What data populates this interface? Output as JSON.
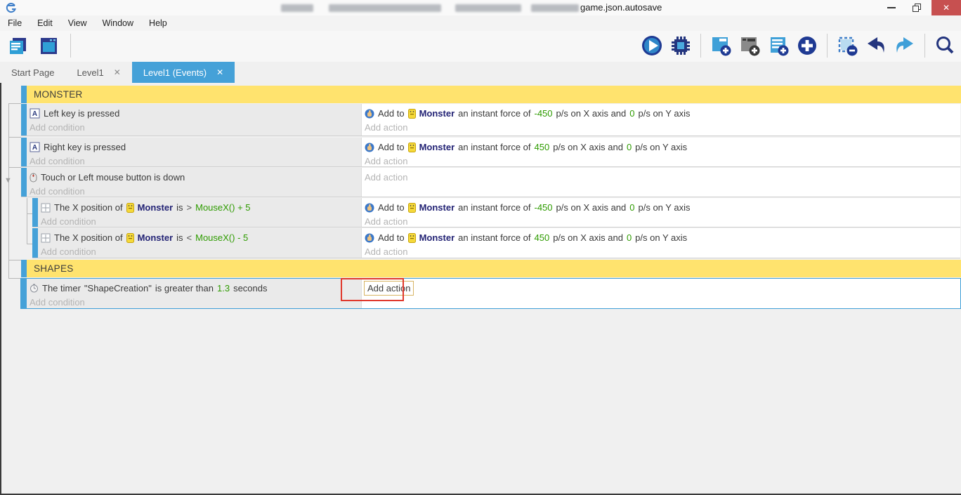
{
  "window": {
    "title_suffix": "game.json.autosave",
    "close_glyph": "✕"
  },
  "menu": {
    "items": [
      "File",
      "Edit",
      "View",
      "Window",
      "Help"
    ]
  },
  "toolbar": {
    "left_icons": [
      "project-manager-icon",
      "scene-editor-icon"
    ],
    "right_icons": [
      "play-icon",
      "debugger-icon",
      "add-event-icon",
      "add-subevent-icon",
      "add-comment-icon",
      "add-new-icon",
      "remove-selection-icon",
      "undo-icon",
      "redo-icon",
      "search-icon"
    ]
  },
  "tabs": {
    "start_page": "Start Page",
    "level1": "Level1",
    "level1_events": "Level1 (Events)",
    "close_glyph": "✕"
  },
  "colors": {
    "accent_blue": "#45a1d8",
    "group_yellow": "#ffe36e",
    "param_green": "#2e9b00",
    "object_navy": "#232375",
    "highlight_red": "#e0382c",
    "placeholder_gray": "#b4b4b4"
  },
  "sheet": {
    "groups": {
      "monster": "MONSTER",
      "shapes": "SHAPES"
    },
    "placeholders": {
      "add_condition": "Add condition",
      "add_action": "Add action"
    },
    "ev_left": {
      "condition": "Left key is pressed"
    },
    "ev_right": {
      "condition": "Right key is pressed"
    },
    "ev_touch": {
      "condition": "Touch or Left mouse button is down"
    },
    "sub_greater": {
      "c0": "The X position of",
      "obj": "Monster",
      "c1": "is",
      "op": ">",
      "expr": "MouseX() + 5"
    },
    "sub_less": {
      "c0": "The X position of",
      "obj": "Monster",
      "c1": "is",
      "op": "<",
      "expr": "MouseX() - 5"
    },
    "ev_timer": {
      "c0": "The timer",
      "timer_name": "\"ShapeCreation\"",
      "c1": "is greater than",
      "value": "1.3",
      "c2": "seconds"
    },
    "force_neg": {
      "a0": "Add to",
      "obj": "Monster",
      "a1": "an instant force of",
      "v1": "-450",
      "a2": "p/s on X axis and",
      "v2": "0",
      "a3": "p/s on Y axis"
    },
    "force_pos": {
      "a0": "Add to",
      "obj": "Monster",
      "a1": "an instant force of",
      "v1": "450",
      "a2": "p/s on X axis and",
      "v2": "0",
      "a3": "p/s on Y axis"
    }
  }
}
